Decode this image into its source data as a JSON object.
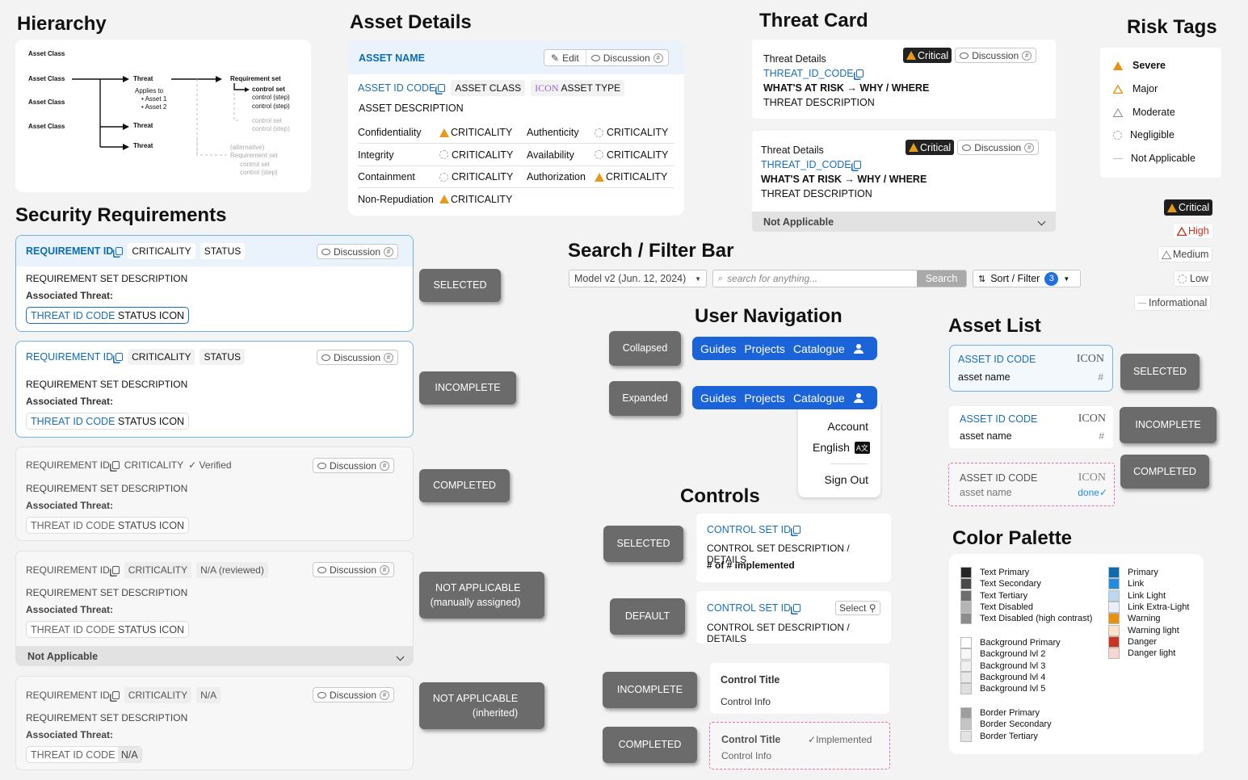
{
  "titles": {
    "hierarchy": "Hierarchy",
    "asset_details": "Asset Details",
    "threat_card": "Threat Card",
    "risk_tags": "Risk Tags",
    "security_requirements": "Security Requirements",
    "search_filter": "Search / Filter Bar",
    "user_navigation": "User Navigation",
    "asset_list": "Asset List",
    "controls": "Controls",
    "color_palette": "Color Palette"
  },
  "hierarchy": {
    "asset_class": "Asset Class",
    "threat": "Threat",
    "applies_to": "Applies to",
    "asset1": "Asset 1",
    "asset2": "Asset 2",
    "requirement_set": "Requirement set",
    "control_set": "control set",
    "control_step": "control (step)",
    "alternative": "(alternative)"
  },
  "asset_details": {
    "name": "ASSET NAME",
    "edit": "Edit",
    "discussion": "Discussion",
    "id_code": "ASSET ID CODE",
    "class": "ASSET CLASS",
    "icon": "ICON",
    "type": "ASSET TYPE",
    "description": "ASSET DESCRIPTION",
    "criticality": "CRITICALITY",
    "rows": [
      [
        "Confidentiality",
        "Authenticity"
      ],
      [
        "Integrity",
        "Availability"
      ],
      [
        "Containment",
        "Authorization"
      ],
      [
        "Non-Repudiation",
        ""
      ]
    ]
  },
  "threat_card": {
    "details": "Threat Details",
    "code": "THREAT_ID_CODE",
    "risk": "WHAT'S AT RISK → WHY / WHERE",
    "description": "THREAT DESCRIPTION",
    "critical": "Critical",
    "discussion": "Discussion",
    "not_applicable": "Not Applicable"
  },
  "risk_tags": {
    "list": [
      "Severe",
      "Major",
      "Moderate",
      "Negligible",
      "Not Applicable"
    ],
    "critical": "Critical",
    "high": "High",
    "medium": "Medium",
    "low": "Low",
    "informational": "Informational"
  },
  "requirements": {
    "id": "REQUIREMENT ID",
    "criticality": "CRITICALITY",
    "status": "STATUS",
    "discussion": "Discussion",
    "description": "REQUIREMENT SET DESCRIPTION",
    "associated": "Associated Threat:",
    "threat_code": "THREAT ID CODE",
    "status_icon": "STATUS ICON",
    "verified": "Verified",
    "na_reviewed": "N/A (reviewed)",
    "na": "N/A",
    "not_applicable": "Not Applicable",
    "labels": [
      "SELECTED",
      "INCOMPLETE",
      "COMPLETED",
      "NOT APPLICABLE\n(manually assigned)",
      "NOT APPLICABLE\n(inherited)"
    ]
  },
  "search": {
    "model": "Model v2 (Jun. 12, 2024)",
    "placeholder": "search for anything...",
    "button": "Search",
    "sort": "Sort / Filter",
    "count": "3"
  },
  "nav": {
    "collapsed": "Collapsed",
    "expanded": "Expanded",
    "guides": "Guides",
    "projects": "Projects",
    "catalogue": "Catalogue",
    "account": "Account",
    "english": "English",
    "sign_out": "Sign Out"
  },
  "asset_list": {
    "code": "ASSET ID CODE",
    "icon": "ICON",
    "name": "asset name",
    "hash": "#",
    "done": "done",
    "labels": [
      "SELECTED",
      "INCOMPLETE",
      "COMPLETED"
    ]
  },
  "controls": {
    "id": "CONTROL SET ID",
    "desc": "CONTROL SET DESCRIPTION / DETAILS",
    "implemented_count": "# of # implemented",
    "select": "Select",
    "title": "Control Title",
    "info": "Control Info",
    "implemented": "Implemented",
    "labels": [
      "SELECTED",
      "DEFAULT",
      "INCOMPLETE",
      "COMPLETED"
    ]
  },
  "palette": {
    "text": [
      {
        "name": "Text Primary",
        "color": "#262626"
      },
      {
        "name": "Text Secondary",
        "color": "#4a4a4a"
      },
      {
        "name": "Text Tertiary",
        "color": "#6e6e6e"
      },
      {
        "name": "Text Disabled",
        "color": "#b5b5b5"
      },
      {
        "name": "Text Disabled (high contrast)",
        "color": "#8c8c8c"
      }
    ],
    "bg": [
      {
        "name": "Background Primary",
        "color": "#ffffff"
      },
      {
        "name": "Background lvl 2",
        "color": "#f7f7f7"
      },
      {
        "name": "Background lvl 3",
        "color": "#f0f0f0"
      },
      {
        "name": "Background lvl 4",
        "color": "#e8e8e8"
      },
      {
        "name": "Background lvl 5",
        "color": "#dedede"
      }
    ],
    "border": [
      {
        "name": "Border Primary",
        "color": "#9e9e9e"
      },
      {
        "name": "Border Secondary",
        "color": "#c4c4c4"
      },
      {
        "name": "Border Tertiary",
        "color": "#e3e3e3"
      }
    ],
    "brand": [
      {
        "name": "Primary",
        "color": "#0b6cb0"
      },
      {
        "name": "Link",
        "color": "#1f8de0"
      },
      {
        "name": "Link Light",
        "color": "#bcd8f1"
      },
      {
        "name": "Link Extra-Light",
        "color": "#e6f1fb"
      },
      {
        "name": "Warning",
        "color": "#e8900f"
      },
      {
        "name": "Warning light",
        "color": "#fbe4c6"
      },
      {
        "name": "Danger",
        "color": "#c9351f"
      },
      {
        "name": "Danger light",
        "color": "#f7d7d0"
      }
    ]
  }
}
